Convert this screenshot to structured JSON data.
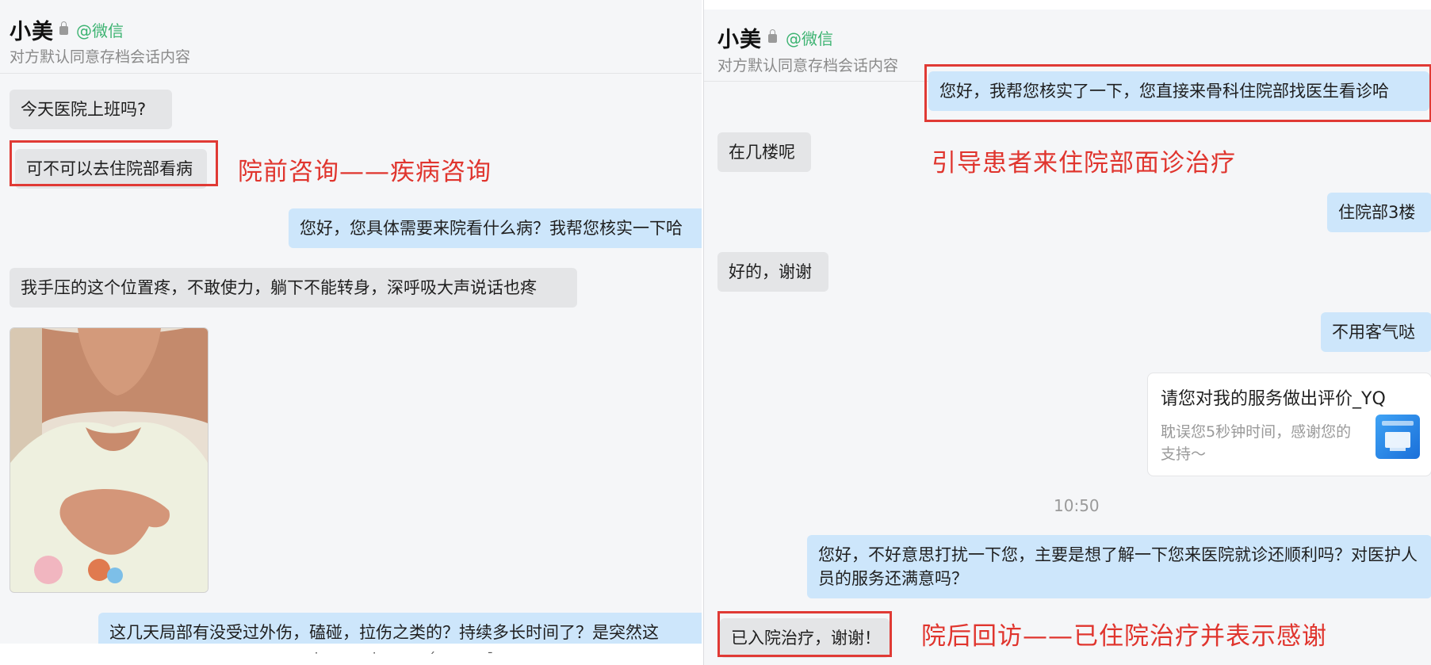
{
  "left": {
    "header": {
      "name": "小美",
      "source": "@微信",
      "subtitle": "对方默认同意存档会话内容"
    },
    "messages": {
      "m1": "今天医院上班吗?",
      "m2": "可不可以去住院部看病",
      "m3": "您好，您具体需要来院看什么病？我帮您核实一下哈",
      "m4": "我手压的这个位置疼，不敢使力，躺下不能转身，深呼吸大声说话也疼",
      "m5": "这几天局部有没受过外伤，磕碰，拉伤之类的？持续多长时间了？是突然这"
    },
    "annotation": "院前咨询——疾病咨询"
  },
  "right": {
    "header": {
      "name": "小美",
      "source": "@微信",
      "subtitle": "对方默认同意存档会话内容"
    },
    "messages": {
      "m1": "您好，我帮您核实了一下，您直接来骨科住院部找医生看诊哈",
      "m2": "在几楼呢",
      "m3": "住院部3楼",
      "m4": "好的，谢谢",
      "m5": "不用客气哒",
      "m6": "您好，不好意思打扰一下您，主要是想了解一下您来医院就诊还顺利吗？对医护人员的服务还满意吗？",
      "m7": "已入院治疗，谢谢！"
    },
    "card": {
      "title": "请您对我的服务做出评价_YQ",
      "desc": "耽误您5秒钟时间，感谢您的支持～",
      "icon": "rating-form-icon"
    },
    "time": "10:50",
    "annotations": {
      "a1": "引导患者来住院部面诊治疗",
      "a2": "院后回访——已住院治疗并表示感谢"
    }
  },
  "colors": {
    "annotation": "#e0352e",
    "outgoing_bubble": "#cde6fb",
    "incoming_bubble": "#e4e5e7",
    "source_tag": "#3cb371"
  }
}
